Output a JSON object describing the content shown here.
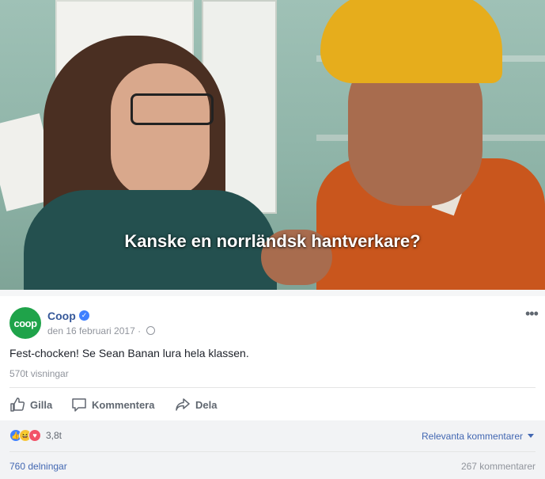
{
  "video": {
    "subtitle": "Kanske en norrländsk hantverkare?"
  },
  "post": {
    "avatar_text": "coop",
    "page_name": "Coop",
    "verified_icon": "verified-check-icon",
    "date": "den 16 februari 2017 · ",
    "privacy_icon": "globe-icon",
    "more_icon": "ellipsis-icon",
    "text": "Fest-chocken! Se Sean Banan lura hela klassen.",
    "views": "570t visningar"
  },
  "actions": {
    "like": "Gilla",
    "comment": "Kommentera",
    "share": "Dela"
  },
  "footer": {
    "reaction_icons": [
      "like-reaction-icon",
      "haha-reaction-icon",
      "love-reaction-icon"
    ],
    "reaction_count": "3,8t",
    "relevant_comments": "Relevanta kommentarer",
    "shares": "760 delningar",
    "comments": "267 kommentarer"
  },
  "colors": {
    "brand_green": "#1fa34a",
    "link_blue": "#365899",
    "accent_blue": "#4267b2",
    "muted_text": "#90949c"
  }
}
